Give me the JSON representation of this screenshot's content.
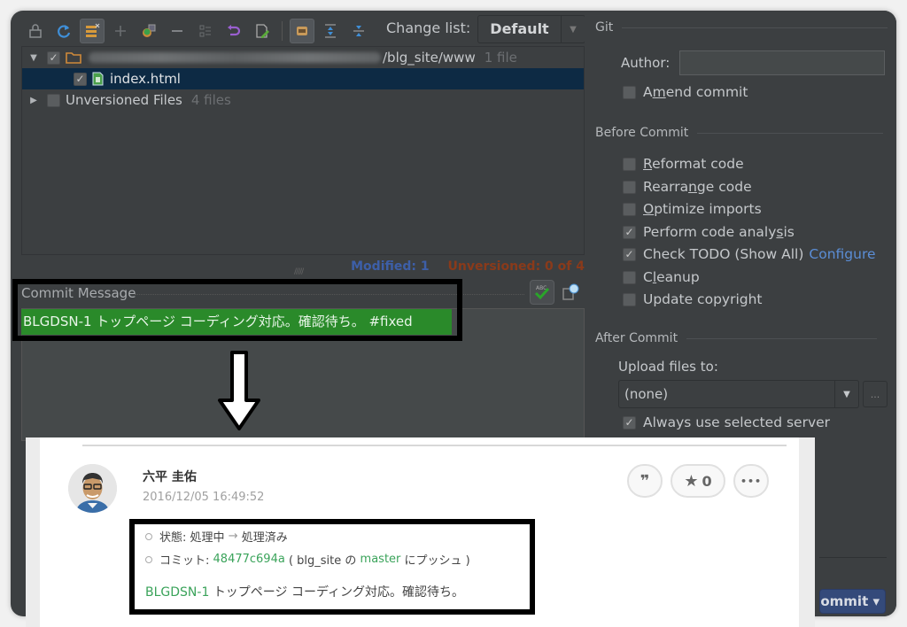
{
  "toolbar": {
    "icons": [
      "lock-icon",
      "refresh-icon",
      "show-diff-icon",
      "add-icon",
      "move-to-changelist-icon",
      "remove-icon",
      "group-by-icon",
      "rollback-icon",
      "edit-source-icon",
      "show-ignored-icon",
      "expand-all-icon",
      "collapse-all-icon"
    ],
    "changelist_label": "Change list:",
    "changelist_value": "Default"
  },
  "tree": {
    "root": {
      "path_suffix": "/blg_site/www",
      "count": "1 file",
      "checked": true
    },
    "file": {
      "name": "index.html",
      "checked": true
    },
    "unversioned": {
      "label": "Unversioned Files",
      "count": "4 files",
      "checked": false
    }
  },
  "status": {
    "modified": "Modified: 1",
    "unversioned": "Unversioned: 0 of 4"
  },
  "commit_message": {
    "label": "Commit Message",
    "text": "BLGDSN-1 トップページ コーディング対応。確認待ち。 #fixed"
  },
  "right_panel": {
    "git_title": "Git",
    "author_label": "Author:",
    "author_value": "",
    "amend_commit": {
      "pre": "A",
      "u": "m",
      "post": "end commit",
      "checked": false
    },
    "before_commit_title": "Before Commit",
    "before_options": [
      {
        "pre": "",
        "u": "R",
        "post": "eformat code",
        "checked": false
      },
      {
        "pre": "Rearra",
        "u": "n",
        "post": "ge code",
        "checked": false
      },
      {
        "pre": "",
        "u": "O",
        "post": "ptimize imports",
        "checked": false
      },
      {
        "pre": "Perform code analy",
        "u": "s",
        "post": "is",
        "checked": true
      },
      {
        "pre": "Check TODO (Show All)",
        "u": "",
        "post": "",
        "checked": true,
        "link": "Configure"
      },
      {
        "pre": "C",
        "u": "l",
        "post": "eanup",
        "checked": false
      },
      {
        "pre": "Update copyright",
        "u": "",
        "post": "",
        "checked": false
      }
    ],
    "after_commit_title": "After Commit",
    "upload_label": "Upload files to:",
    "upload_value": "(none)",
    "more_label": "...",
    "always_use_server": {
      "label": "Always use selected server",
      "checked": true
    },
    "commit_button": "ommit ▾"
  },
  "comment_card": {
    "user_name": "六平 圭佑",
    "timestamp": "2016/12/05 16:49:52",
    "quote_button": "❞",
    "star_count": "0",
    "more_button": "•••",
    "status_label": "状態:",
    "status_from": "処理中",
    "status_arrow": "→",
    "status_to": "処理済み",
    "commit_label": "コミット:",
    "commit_hash": "48477c694a",
    "commit_paren_open": "( blg_site の",
    "branch": "master",
    "commit_paren_close": "にプッシュ )",
    "issue_key": "BLGDSN-1",
    "message": "トップページ コーディング対応。確認待ち。"
  }
}
